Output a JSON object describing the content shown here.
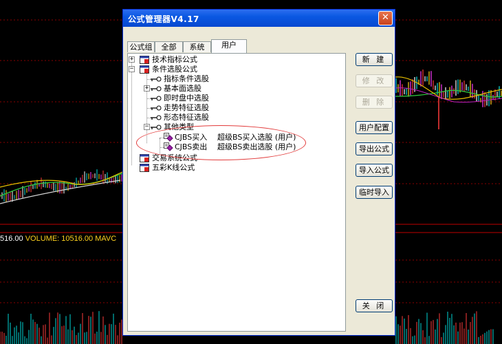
{
  "background": {
    "volume_readout": {
      "left_value": "516.00",
      "label": "VOLUME: 10516.00",
      "suffix": "MAVC"
    }
  },
  "window": {
    "title": "公式管理器V4.17",
    "close_symbol": "✕",
    "tabs": [
      {
        "label": "公式组",
        "active": false
      },
      {
        "label": "全部",
        "active": false
      },
      {
        "label": "系统",
        "active": false
      },
      {
        "label": "用户",
        "active": true
      }
    ],
    "tree": {
      "technical_indicators": "技术指标公式",
      "stock_selection": "条件选股公式",
      "children": [
        {
          "label": "指标条件选股",
          "expandable": false
        },
        {
          "label": "基本面选股",
          "expandable": true
        },
        {
          "label": "即时盘中选股",
          "expandable": false
        },
        {
          "label": "走势特征选股",
          "expandable": false
        },
        {
          "label": "形态特征选股",
          "expandable": false
        },
        {
          "label": "其他类型",
          "expanded": true
        }
      ],
      "formulas": [
        {
          "code": "CJBS买入",
          "description": "超级BS买入选股 (用户)"
        },
        {
          "code": "CJBS卖出",
          "description": "超级BS卖出选股 (用户)"
        }
      ],
      "trading_system": "交易系统公式",
      "candlestick": "五彩K线公式"
    },
    "buttons": {
      "new": "新 建",
      "modify": "修 改",
      "delete": "删 除",
      "user_config": "用户配置",
      "export": "导出公式",
      "import": "导入公式",
      "temp_import": "临时导入",
      "close": "关 闭"
    }
  },
  "colors": {
    "title_bar": "#0a58e2",
    "annotation_circle": "#e23b3b",
    "volume_text": "#ffd21e"
  }
}
